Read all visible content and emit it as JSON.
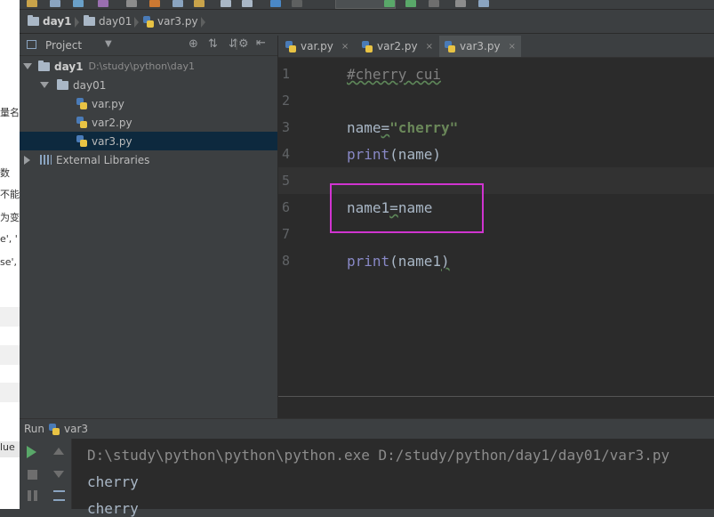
{
  "breadcrumbs": [
    {
      "label": "day1",
      "icon": "folder-icon"
    },
    {
      "label": "day01",
      "icon": "folder-icon"
    },
    {
      "label": "var3.py",
      "icon": "python-file-icon"
    }
  ],
  "toolbar": {
    "run_config": "var3"
  },
  "project_panel": {
    "title": "Project",
    "tree": [
      {
        "label": "day1",
        "path": "D:\\study\\python\\day1",
        "expanded": true
      },
      {
        "label": "day01",
        "expanded": true
      },
      {
        "label": "var.py"
      },
      {
        "label": "var2.py"
      },
      {
        "label": "var3.py",
        "selected": true
      },
      {
        "label": "External Libraries",
        "expanded": false
      }
    ]
  },
  "editor": {
    "tabs": [
      {
        "label": "var.py",
        "close": "×"
      },
      {
        "label": "var2.py",
        "close": "×"
      },
      {
        "label": "var3.py",
        "close": "×",
        "active": true
      }
    ],
    "lines": [
      {
        "num": "1",
        "parts": [
          {
            "t": "#cherry cui",
            "c": "c-comment squig"
          }
        ]
      },
      {
        "num": "2",
        "parts": []
      },
      {
        "num": "3",
        "parts": [
          {
            "t": "name",
            "c": "c-name"
          },
          {
            "t": "=",
            "c": "c-name squig"
          },
          {
            "t": "\"cherry\"",
            "c": "c-str"
          }
        ]
      },
      {
        "num": "4",
        "parts": [
          {
            "t": "print",
            "c": "c-builtin"
          },
          {
            "t": "(name)",
            "c": "c-paren"
          }
        ]
      },
      {
        "num": "5",
        "parts": [],
        "current": true
      },
      {
        "num": "6",
        "parts": [
          {
            "t": "name1",
            "c": "c-name"
          },
          {
            "t": "=",
            "c": "c-name squig"
          },
          {
            "t": "name",
            "c": "c-name"
          }
        ]
      },
      {
        "num": "7",
        "parts": []
      },
      {
        "num": "8",
        "parts": [
          {
            "t": "print",
            "c": "c-builtin"
          },
          {
            "t": "(name1",
            "c": "c-paren"
          },
          {
            "t": ")",
            "c": "c-paren squig"
          }
        ]
      }
    ]
  },
  "run": {
    "title": "Run",
    "config": "var3",
    "output": [
      {
        "text": "D:\\study\\python\\python\\python.exe D:/study/python/day1/day01/var3.py",
        "color": "#8c8c8c"
      },
      {
        "text": "cherry",
        "color": "#a9b7c6"
      },
      {
        "text": "cherry",
        "color": "#a9b7c6"
      }
    ]
  },
  "page_sliver": {
    "rows": [
      "",
      "",
      "",
      "",
      "",
      "量名",
      "",
      "",
      " 数",
      "不能",
      "为变",
      "e', '",
      "se',",
      "",
      "",
      "",
      "",
      "",
      "",
      "",
      "",
      "",
      "",
      "",
      "lue"
    ]
  },
  "colors": {
    "highlight_box": "#d034d0",
    "selection": "#0d293e"
  }
}
